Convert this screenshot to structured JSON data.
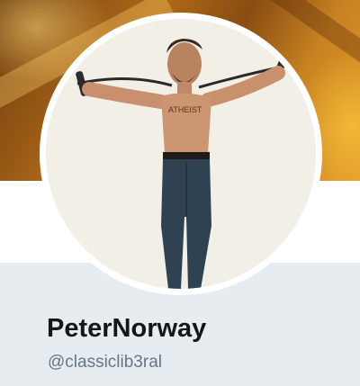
{
  "profile": {
    "display_name": "PeterNorway",
    "handle": "@classiclib3ral"
  },
  "colors": {
    "page_background": "#e6ecf0",
    "name_text": "#14171a",
    "handle_text": "#657786",
    "banner_accent": "#c98422"
  },
  "icons": {
    "avatar": "profile-photo"
  }
}
